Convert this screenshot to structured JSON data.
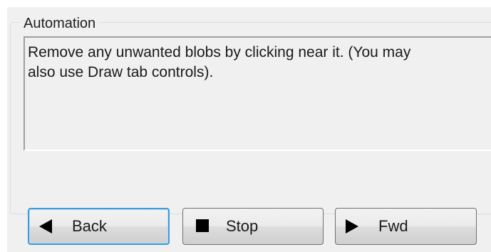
{
  "automation": {
    "legend": "Automation",
    "description_line1": "Remove any unwanted blobs by clicking near it.  (You may",
    "description_line2": "also use Draw tab controls)."
  },
  "buttons": {
    "back_label": "Back",
    "stop_label": "Stop",
    "fwd_label": "Fwd",
    "back_icon": "triangle-left-icon",
    "stop_icon": "square-stop-icon",
    "fwd_icon": "triangle-right-icon"
  },
  "colors": {
    "panel_bg": "#f0f0f0",
    "focus_border": "#3c9bd8",
    "text": "#1a1a1a"
  }
}
